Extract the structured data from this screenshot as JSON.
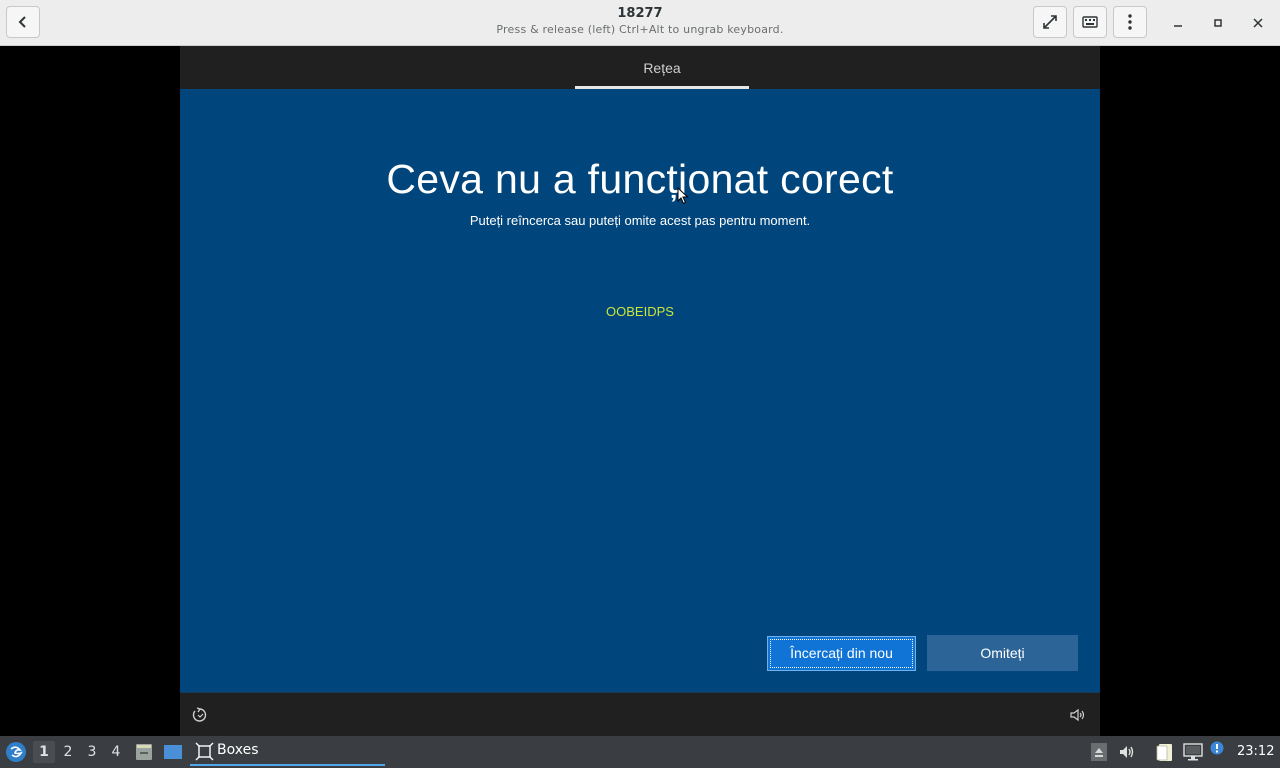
{
  "header": {
    "title": "18277",
    "subtitle": "Press & release (left) Ctrl+Alt to ungrab keyboard."
  },
  "vm": {
    "tab_label": "Rețea",
    "headline": "Ceva nu a funcționat corect",
    "subtext": "Puteți reîncerca sau puteți omite acest pas pentru moment.",
    "error_code": "OOBEIDPS",
    "retry_label": "Încercați din nou",
    "skip_label": "Omiteți",
    "accent_color": "#00457b",
    "error_code_color": "#c8e63c"
  },
  "taskbar": {
    "workspaces": [
      "1",
      "2",
      "3",
      "4"
    ],
    "active_workspace": "1",
    "task_label": "Boxes",
    "clock": "23:12"
  },
  "icons": {
    "header": [
      "back-icon",
      "fullscreen-icon",
      "keyboard-icon",
      "menu-icon",
      "minimize-icon",
      "maximize-icon",
      "close-icon"
    ],
    "vm": [
      "ease-of-access-icon",
      "volume-icon"
    ],
    "taskbar": [
      "start-menu-icon",
      "file-manager-icon",
      "show-desktop-icon",
      "boxes-app-icon",
      "eject-icon",
      "volume-icon",
      "clipboard-icon",
      "network-icon",
      "notification-icon"
    ]
  }
}
